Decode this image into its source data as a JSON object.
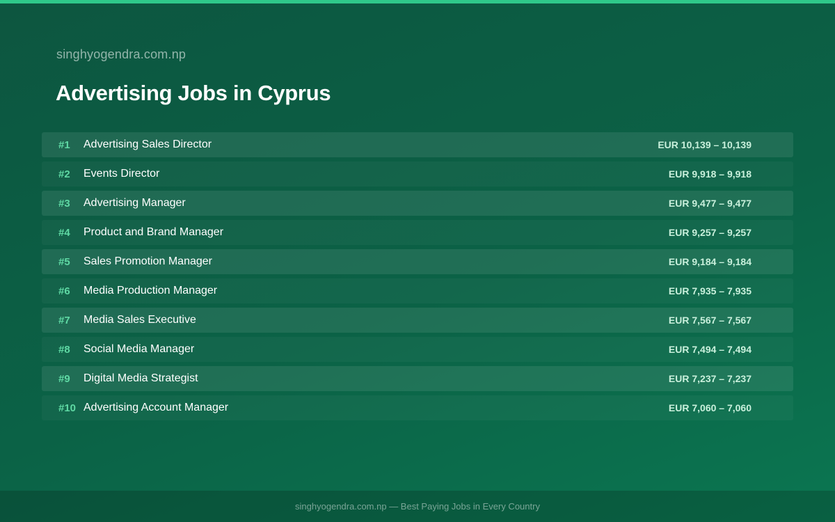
{
  "header": {
    "site_name": "singhyogendra.com.np",
    "title": "Advertising Jobs in Cyprus"
  },
  "jobs": [
    {
      "rank": "#1",
      "title": "Advertising Sales Director",
      "salary": "EUR 10,139 – 10,139"
    },
    {
      "rank": "#2",
      "title": "Events Director",
      "salary": "EUR 9,918 – 9,918"
    },
    {
      "rank": "#3",
      "title": "Advertising Manager",
      "salary": "EUR 9,477 – 9,477"
    },
    {
      "rank": "#4",
      "title": "Product and Brand Manager",
      "salary": "EUR 9,257 – 9,257"
    },
    {
      "rank": "#5",
      "title": "Sales Promotion Manager",
      "salary": "EUR 9,184 – 9,184"
    },
    {
      "rank": "#6",
      "title": "Media Production Manager",
      "salary": "EUR 7,935 – 7,935"
    },
    {
      "rank": "#7",
      "title": "Media Sales Executive",
      "salary": "EUR 7,567 – 7,567"
    },
    {
      "rank": "#8",
      "title": "Social Media Manager",
      "salary": "EUR 7,494 – 7,494"
    },
    {
      "rank": "#9",
      "title": "Digital Media Strategist",
      "salary": "EUR 7,237 – 7,237"
    },
    {
      "rank": "#10",
      "title": "Advertising Account Manager",
      "salary": "EUR 7,060 – 7,060"
    }
  ],
  "footer": {
    "text": "singhyogendra.com.np — Best Paying Jobs in Every Country"
  },
  "colors": {
    "accent": "#2fc88a",
    "rank": "#5fd9a4",
    "background": "#0b6246"
  }
}
